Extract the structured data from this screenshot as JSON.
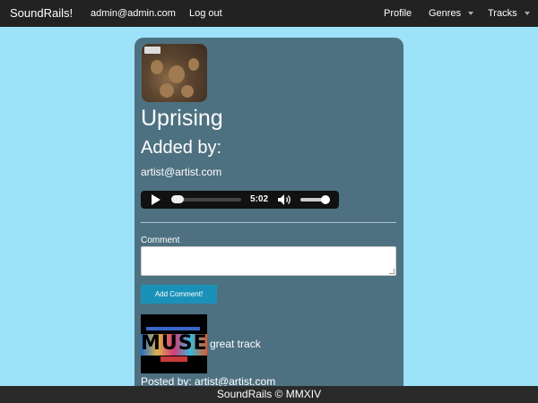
{
  "navbar": {
    "brand": "SoundRails!",
    "user": "admin@admin.com",
    "logout": "Log out",
    "profile": "Profile",
    "genres": "Genres",
    "tracks": "Tracks"
  },
  "track": {
    "title": "Uprising",
    "added_by_label": "Added by:",
    "artist": "artist@artist.com"
  },
  "player": {
    "time": "5:02",
    "progress": 0.05,
    "volume": 0.8
  },
  "comment_form": {
    "label": "Comment",
    "value": "",
    "submit_label": "Add Comment!"
  },
  "comments": [
    {
      "text": "great track",
      "posted_by": "Posted by: artist@artist.com",
      "avatar_text": "MUSE"
    }
  ],
  "footer": {
    "text": "SoundRails © MMXIV"
  },
  "colors": {
    "background": "#9ee2fa",
    "card": "#4e7181",
    "navbar": "#222222",
    "button": "#1a91b9"
  }
}
